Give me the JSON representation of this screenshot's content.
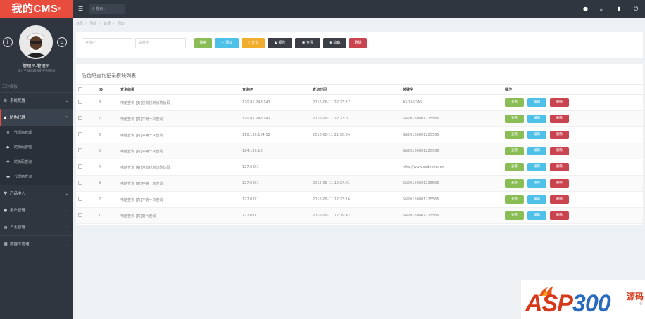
{
  "app": {
    "logo": "我的CMS",
    "logo_mark": "®"
  },
  "user": {
    "name": "管理员-管理员",
    "subtitle": "致力于做出最棒的产品系统"
  },
  "sidebar": {
    "section_title": "工作面板",
    "items": [
      {
        "label": "系统配置",
        "icon": "gears-icon"
      },
      {
        "label": "防伪代理",
        "icon": "warning-icon",
        "active": true,
        "children": [
          {
            "label": "代理商管理",
            "icon": "star-icon"
          },
          {
            "label": "防伪码管理",
            "icon": "tag-icon"
          },
          {
            "label": "防伪码查询",
            "icon": "cog-icon"
          },
          {
            "label": "代理商查询",
            "icon": "folder-icon"
          }
        ]
      },
      {
        "label": "产品中心",
        "icon": "heart-icon"
      },
      {
        "label": "用户管理",
        "icon": "users-icon"
      },
      {
        "label": "日志管理",
        "icon": "log-icon"
      },
      {
        "label": "数据库管理",
        "icon": "database-icon"
      }
    ]
  },
  "topbar": {
    "search_placeholder": "搜索..."
  },
  "breadcrumb": [
    "首页",
    "列表",
    "数据",
    "列表"
  ],
  "filters": {
    "ip_placeholder": "查询IP",
    "keyword_placeholder": "关键字",
    "buttons": {
      "search": "搜索",
      "add": "添加",
      "enable": "开启",
      "report": "报告",
      "view": "查看",
      "hide": "隐藏",
      "delete": "删除"
    }
  },
  "table": {
    "title": "防伪码查询记录模块列表",
    "columns": [
      "",
      "ID",
      "查询结果",
      "查询IP",
      "查询时间",
      "关键字",
      "操作"
    ],
    "actions": {
      "view": "查看",
      "edit": "编辑",
      "delete": "删除"
    },
    "rows": [
      {
        "id": "8",
        "result": "电脑查询 [第]没有找到该防伪码",
        "ip": "120.85.248.141",
        "time": "2016-08-11 22:23:17",
        "keyword": "ASDASDAS"
      },
      {
        "id": "7",
        "result": "电脑查询 [真]冲第一次查询",
        "ip": "120.85.248.141",
        "time": "2016-08-11 22:23:01",
        "keyword": "SN20160801225566"
      },
      {
        "id": "6",
        "result": "电脑查询 [真]冲第一次查询",
        "ip": "110.130.184.52",
        "time": "2016-08-11 21:00:24",
        "keyword": "SN20160801225566"
      },
      {
        "id": "5",
        "result": "电脑查询 [真]冲第一次查询",
        "ip": "124.130.16",
        "time": "",
        "keyword": "SN20160801225566"
      },
      {
        "id": "4",
        "result": "电脑查询 [第]没有找到该防伪码",
        "ip": "127.0.0.1",
        "time": "",
        "keyword": "http://www.asdecms.cn"
      },
      {
        "id": "3",
        "result": "电脑查询 [真]冲第一次查询",
        "ip": "127.0.0.1",
        "time": "2016-08-11 12:24:01",
        "keyword": "SN20160801225566"
      },
      {
        "id": "2",
        "result": "电脑查询 [真]冲第一次查询",
        "ip": "127.0.0.1",
        "time": "2016-08-11 12:23:16",
        "keyword": "SN20160801225566"
      },
      {
        "id": "1",
        "result": "电脑查询 [真]第六查询",
        "ip": "127.0.0.1",
        "time": "2016-08-11 12:19:42",
        "keyword": "SN20160801225566"
      }
    ]
  },
  "watermark": {
    "brand_main": "ASP",
    "brand_num": "300",
    "suffix": "源码",
    "mark": "®"
  },
  "colors": {
    "sidebar": "#2f3640",
    "logo": "#e84c3d",
    "green": "#8bbd56",
    "blue": "#4fc1e9",
    "orange": "#f0ad2e",
    "dark": "#3b3f45",
    "red": "#c9444f"
  }
}
